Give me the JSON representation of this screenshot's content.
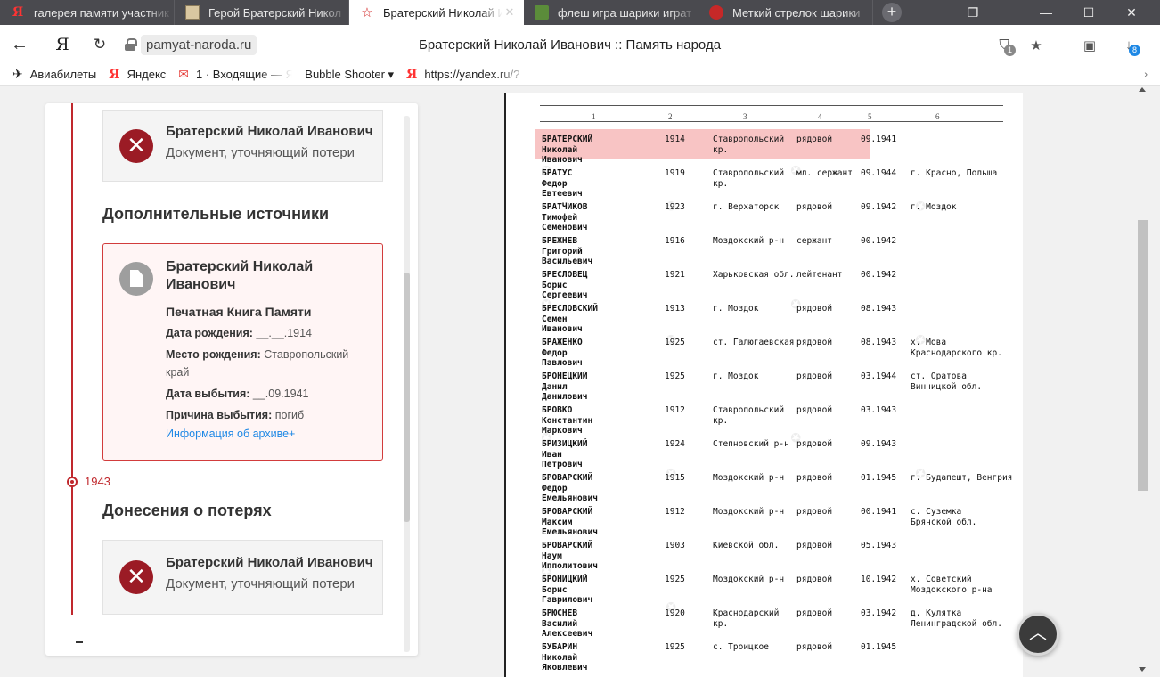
{
  "browser": {
    "tabs": [
      {
        "title": "галерея памяти участник",
        "icon": "yandex-icon"
      },
      {
        "title": "Герой Братерский Никол",
        "icon": "image-icon"
      },
      {
        "title": "Братерский Николай И",
        "icon": "star-icon"
      },
      {
        "title": "флеш игра шарики играт",
        "icon": "game-icon"
      },
      {
        "title": "Меткий стрелок шарики",
        "icon": "bird-icon"
      }
    ],
    "window_controls": {
      "minimize": "—",
      "maximize": "☐",
      "close": "✕"
    },
    "url_domain": "pamyat-naroda.ru",
    "page_title": "Братерский Николай Иванович :: Память народа",
    "downloads_count": "8",
    "protect_count": "1"
  },
  "bookmarks": [
    {
      "label": "Авиабилеты",
      "icon": "plane-icon"
    },
    {
      "label": "Яндекс",
      "icon": "yandex-icon"
    },
    {
      "label": "1 · Входящие — Ян",
      "icon": "mail-icon"
    },
    {
      "label": "Bubble Shooter ▾",
      "icon": ""
    },
    {
      "label": "https://yandex.ru/?",
      "icon": "yandex-icon"
    }
  ],
  "timeline": {
    "entry_top": {
      "name": "Братерский Николай Иванович",
      "desc": "Документ, уточняющий потери"
    },
    "extra_sources_heading": "Дополнительные источники",
    "source": {
      "name": "Братерский Николай Иванович",
      "book": "Печатная Книга Памяти",
      "birth_label": "Дата рождения:",
      "birth_value": "__.__.1914",
      "place_label": "Место рождения:",
      "place_value": "Ставропольский край",
      "leave_label": "Дата выбытия:",
      "leave_value": "__.09.1941",
      "reason_label": "Причина выбытия:",
      "reason_value": "погиб",
      "archive_link": "Информация об архиве+"
    },
    "year": "1943",
    "losses_heading": "Донесения о потерях",
    "entry_bottom": {
      "name": "Братерский Николай Иванович",
      "desc": "Документ, уточняющий потери"
    }
  },
  "scan": {
    "column_numbers": [
      "1",
      "2",
      "3",
      "4",
      "5",
      "6"
    ],
    "rows": [
      {
        "name": "БРАТЕРСКИЙ\nНиколай\nИванович",
        "year": "1914",
        "place": "Ставропольский\nкр.",
        "rank": "рядовой",
        "date": "09.1941",
        "burial": ""
      },
      {
        "name": "БРАТУС\nФедор\nЕвтеевич",
        "year": "1919",
        "place": "Ставропольский\nкр.",
        "rank": "мл. сержант",
        "date": "09.1944",
        "burial": "г. Красно, Польша"
      },
      {
        "name": "БРАТЧИКОВ\nТимофей\nСеменович",
        "year": "1923",
        "place": "г. Верхаторск",
        "rank": "рядовой",
        "date": "09.1942",
        "burial": "г. Моздок"
      },
      {
        "name": "БРЕЖНЕВ\nГригорий\nВасильевич",
        "year": "1916",
        "place": "Моздокский р-н",
        "rank": "сержант",
        "date": "00.1942",
        "burial": ""
      },
      {
        "name": "БРЕСЛОВЕЦ\nБорис\nСергеевич",
        "year": "1921",
        "place": "Харьковская обл.",
        "rank": "лейтенант",
        "date": "00.1942",
        "burial": ""
      },
      {
        "name": "БРЕСЛОВСКИЙ\nСемен\nИванович",
        "year": "1913",
        "place": "г. Моздок",
        "rank": "рядовой",
        "date": "08.1943",
        "burial": ""
      },
      {
        "name": "БРАЖЕНКО\nФедор\nПавлович",
        "year": "1925",
        "place": "ст. Галюгаевская",
        "rank": "рядовой",
        "date": "08.1943",
        "burial": "х. Мова\nКраснодарского кр."
      },
      {
        "name": "БРОНЕЦКИЙ\nДанил\nДанилович",
        "year": "1925",
        "place": "г. Моздок",
        "rank": "рядовой",
        "date": "03.1944",
        "burial": "ст. Оратова\nВинницкой обл."
      },
      {
        "name": "БРОВКО\nКонстантин\nМаркович",
        "year": "1912",
        "place": "Ставропольский\nкр.",
        "rank": "рядовой",
        "date": "03.1943",
        "burial": ""
      },
      {
        "name": "БРИЗИЦКИЙ\nИван\nПетрович",
        "year": "1924",
        "place": "Степновский р-н",
        "rank": "рядовой",
        "date": "09.1943",
        "burial": ""
      },
      {
        "name": "БРОВАРСКИЙ\nФедор\nЕмельянович",
        "year": "1915",
        "place": "Моздокский р-н",
        "rank": "рядовой",
        "date": "01.1945",
        "burial": "г. Будапешт, Венгрия"
      },
      {
        "name": "БРОВАРСКИЙ\nМаксим\nЕмельянович",
        "year": "1912",
        "place": "Моздокский р-н",
        "rank": "рядовой",
        "date": "00.1941",
        "burial": "с. Суземка\nБрянской обл."
      },
      {
        "name": "БРОВАРСКИЙ\nНаум\nИпполитович",
        "year": "1903",
        "place": "Киевской обл.",
        "rank": "рядовой",
        "date": "05.1943",
        "burial": ""
      },
      {
        "name": "БРОНИЦКИЙ\nБорис\nГаврилович",
        "year": "1925",
        "place": "Моздокский р-н",
        "rank": "рядовой",
        "date": "10.1942",
        "burial": "х. Советский\nМоздокского р-на"
      },
      {
        "name": "БРЮСНЕВ\nВасилий\nАлексеевич",
        "year": "1920",
        "place": "Краснодарский\nкр.",
        "rank": "рядовой",
        "date": "03.1942",
        "burial": "д. Кулятка\nЛенинградской обл."
      },
      {
        "name": "БУБАРИН\nНиколай\nЯковлевич",
        "year": "1925",
        "place": "с. Троицкое",
        "rank": "рядовой",
        "date": "01.1945",
        "burial": ""
      }
    ]
  },
  "colors": {
    "accent_red": "#c0282d",
    "link_blue": "#1e88e5",
    "highlight": "#f8c4c4"
  }
}
